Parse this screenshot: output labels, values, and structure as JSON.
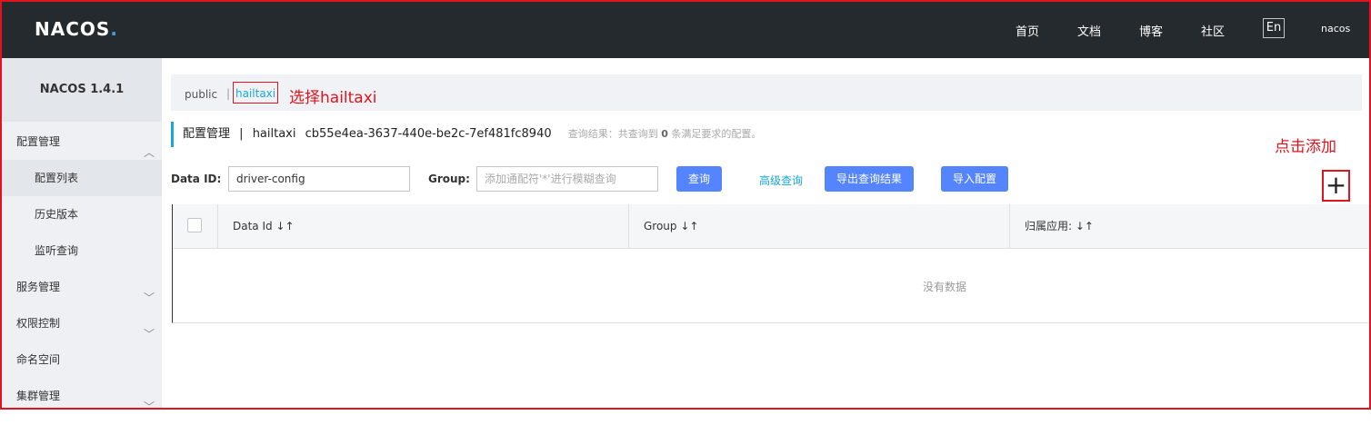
{
  "header": {
    "logo_text": "NACOS",
    "logo_dot": ".",
    "nav": [
      "首页",
      "文档",
      "博客",
      "社区"
    ],
    "lang": "En",
    "user": "nacos"
  },
  "sidebar": {
    "title": "NACOS 1.4.1",
    "items": [
      {
        "label": "配置管理",
        "chevron": "︿"
      },
      {
        "label": "配置列表"
      },
      {
        "label": "历史版本"
      },
      {
        "label": "监听查询"
      },
      {
        "label": "服务管理",
        "chevron": "﹀"
      },
      {
        "label": "权限控制",
        "chevron": "﹀"
      },
      {
        "label": "命名空间"
      },
      {
        "label": "集群管理",
        "chevron": "﹀"
      }
    ]
  },
  "namespace": {
    "public": "public",
    "separator": "|",
    "selected": "hailtaxi"
  },
  "annotations": {
    "select": "选择hailtaxi",
    "add": "点击添加"
  },
  "title_row": {
    "section": "配置管理",
    "sep": "|",
    "ns_name": "hailtaxi",
    "ns_id": "cb55e4ea-3637-440e-be2c-7ef481fc8940",
    "hint_prefix": "查询结果：共查询到",
    "hint_count": "0",
    "hint_suffix": "条满足要求的配置。"
  },
  "search": {
    "data_id_label": "Data ID:",
    "data_id_value": "driver-config",
    "group_label": "Group:",
    "group_placeholder": "添加通配符'*'进行模糊查询",
    "query_btn": "查询",
    "advanced_link": "高级查询",
    "export_btn": "导出查询结果",
    "import_btn": "导入配置",
    "add_icon": "+"
  },
  "table": {
    "columns": [
      "Data Id",
      "Group",
      "归属应用:"
    ],
    "sort_icon": "↓↑",
    "empty": "没有数据"
  },
  "colors": {
    "topbar": "#252a2f",
    "primary_button": "#5584ff",
    "link": "#1aa8d8",
    "annotation_red": "#e0141e"
  }
}
